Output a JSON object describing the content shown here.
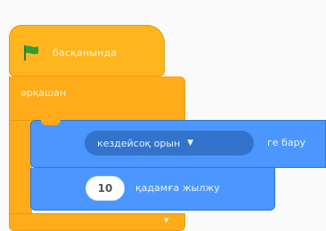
{
  "hat_block": {
    "label": "басқанында",
    "icon": "green-flag-icon",
    "color": "#ffb51e"
  },
  "forever_block": {
    "label": "әрқашан",
    "color": "#ffab1a"
  },
  "motion_block_1": {
    "dropdown_value": "кездейсоқ орын",
    "tail_label": "ге бару",
    "color": "#4c97ff"
  },
  "motion_block_2": {
    "input_value": "10",
    "label": "қадамға жылжу"
  },
  "colors": {
    "flag": "#2e9e3a",
    "motion": "#4c97ff",
    "control": "#ffab1a"
  }
}
